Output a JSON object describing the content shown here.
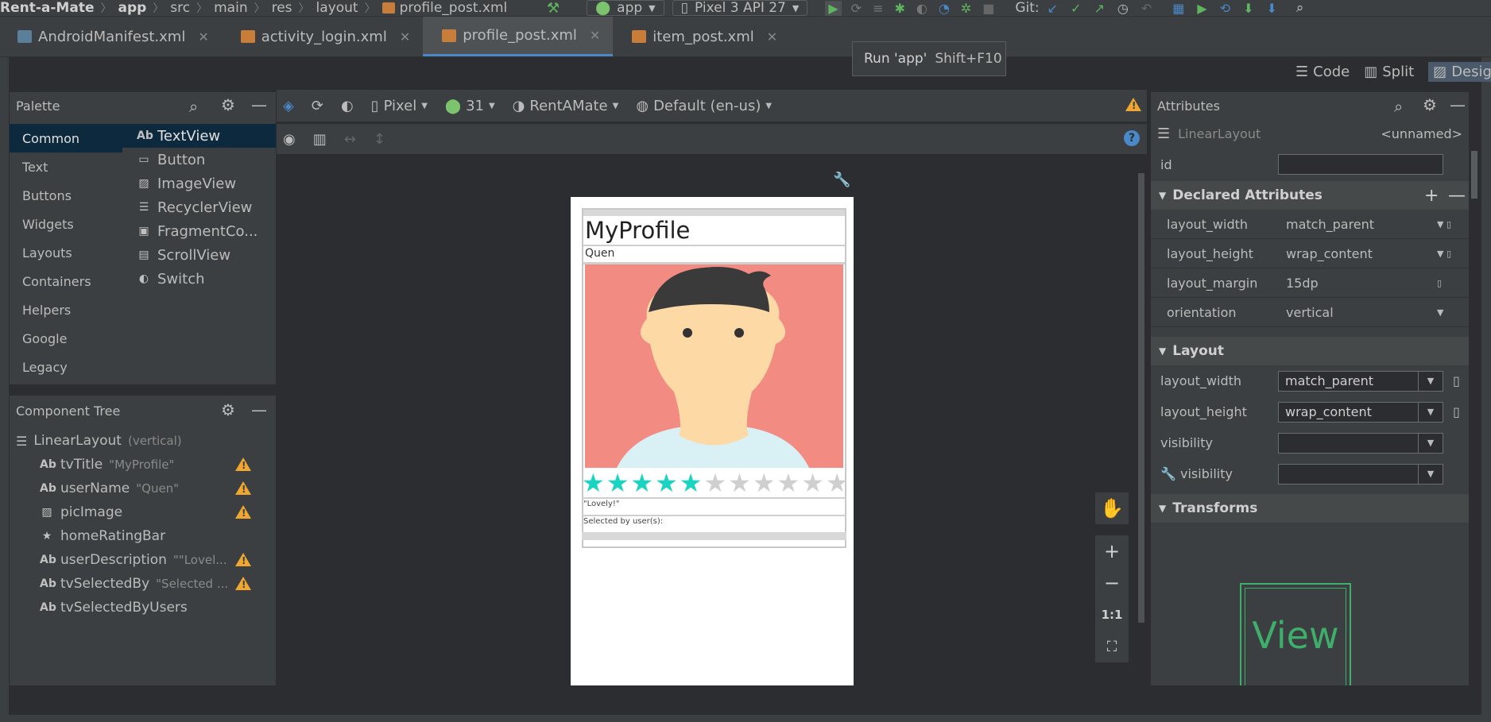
{
  "breadcrumb": [
    "Rent-a-Mate",
    "app",
    "src",
    "main",
    "res",
    "layout",
    "profile_post.xml"
  ],
  "toolbar": {
    "config_label": "app",
    "device_label": "Pixel 3 API 27",
    "git_label": "Git:"
  },
  "tabs": [
    {
      "label": "AndroidManifest.xml",
      "active": false
    },
    {
      "label": "activity_login.xml",
      "active": false
    },
    {
      "label": "profile_post.xml",
      "active": true
    },
    {
      "label": "item_post.xml",
      "active": false
    }
  ],
  "tooltip": {
    "text": "Run 'app'",
    "shortcut": "Shift+F10"
  },
  "view_modes": {
    "code": "Code",
    "split": "Split",
    "design": "Design"
  },
  "palette": {
    "title": "Palette",
    "categories": [
      "Common",
      "Text",
      "Buttons",
      "Widgets",
      "Layouts",
      "Containers",
      "Helpers",
      "Google",
      "Legacy"
    ],
    "items": [
      {
        "icon": "Ab",
        "label": "TextView"
      },
      {
        "icon": "▭",
        "label": "Button"
      },
      {
        "icon": "▨",
        "label": "ImageView"
      },
      {
        "icon": "☰",
        "label": "RecyclerView"
      },
      {
        "icon": "▣",
        "label": "FragmentCo..."
      },
      {
        "icon": "▤",
        "label": "ScrollView"
      },
      {
        "icon": "◐",
        "label": "Switch"
      }
    ]
  },
  "component_tree": {
    "title": "Component Tree",
    "root": {
      "label": "LinearLayout",
      "hint": "(vertical)"
    },
    "nodes": [
      {
        "icon": "Ab",
        "label": "tvTitle",
        "hint": "\"MyProfile\"",
        "warning": true
      },
      {
        "icon": "Ab",
        "label": "userName",
        "hint": "\"Quen\"",
        "warning": true
      },
      {
        "icon": "▨",
        "label": "picImage",
        "hint": "",
        "warning": true
      },
      {
        "icon": "★",
        "label": "homeRatingBar",
        "hint": "",
        "warning": false
      },
      {
        "icon": "Ab",
        "label": "userDescription",
        "hint": "\"\"Lovel...",
        "warning": true
      },
      {
        "icon": "Ab",
        "label": "tvSelectedBy",
        "hint": "\"Selected ...",
        "warning": true
      },
      {
        "icon": "Ab",
        "label": "tvSelectedByUsers",
        "hint": "",
        "warning": false
      }
    ]
  },
  "design_toolbar": {
    "device": "Pixel",
    "api": "31",
    "theme": "RentAMate",
    "locale": "Default (en-us)"
  },
  "preview": {
    "title": "MyProfile",
    "username": "Quen",
    "rating_filled": 5,
    "rating_total": 11,
    "description": "\"Lovely!\"",
    "selected_by": "Selected by user(s):",
    "avatar_bg": "#f28b82",
    "skin": "#fdd9a5",
    "hair": "#3a3a3a",
    "shirt": "#d9f1f5",
    "star_on": "#18d4c0",
    "star_off": "#cfcfcf"
  },
  "zoom": {
    "one_to_one": "1:1"
  },
  "attributes": {
    "title": "Attributes",
    "component": "LinearLayout",
    "component_name": "<unnamed>",
    "id_label": "id",
    "declared_title": "Declared Attributes",
    "declared": [
      {
        "key": "layout_width",
        "value": "match_parent",
        "dropdown": true
      },
      {
        "key": "layout_height",
        "value": "wrap_content",
        "dropdown": true
      },
      {
        "key": "layout_margin",
        "value": "15dp",
        "dropdown": false
      },
      {
        "key": "orientation",
        "value": "vertical",
        "dropdown": true
      }
    ],
    "layout_title": "Layout",
    "layout": [
      {
        "key": "layout_width",
        "value": "match_parent"
      },
      {
        "key": "layout_height",
        "value": "wrap_content"
      },
      {
        "key": "visibility",
        "value": ""
      },
      {
        "key": "visibility",
        "value": ""
      }
    ],
    "transforms_title": "Transforms",
    "view_preview_label": "View"
  },
  "colors": {
    "accent": "#4a88c7",
    "warning": "#f0a732",
    "selection": "#0d293e"
  }
}
